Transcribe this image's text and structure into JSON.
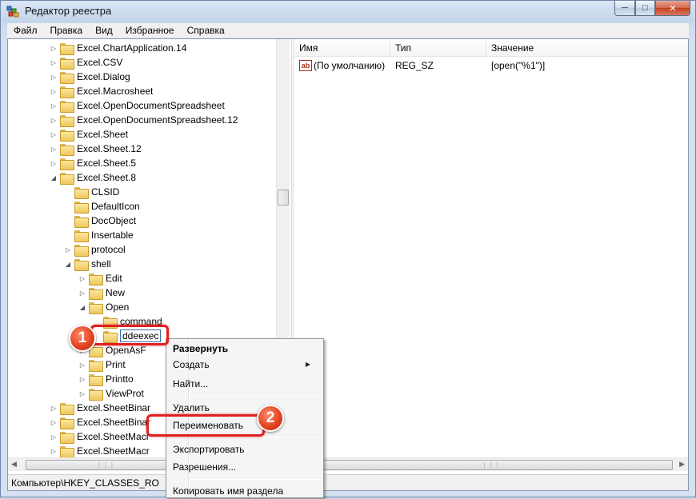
{
  "window": {
    "title": "Редактор реестра"
  },
  "menubar": {
    "items": [
      "Файл",
      "Правка",
      "Вид",
      "Избранное",
      "Справка"
    ]
  },
  "tree": {
    "rows": [
      {
        "label": "Excel.ChartApplication.14",
        "depth": 0,
        "expanded": false
      },
      {
        "label": "Excel.CSV",
        "depth": 0,
        "expanded": false
      },
      {
        "label": "Excel.Dialog",
        "depth": 0,
        "expanded": false
      },
      {
        "label": "Excel.Macrosheet",
        "depth": 0,
        "expanded": false
      },
      {
        "label": "Excel.OpenDocumentSpreadsheet",
        "depth": 0,
        "expanded": false
      },
      {
        "label": "Excel.OpenDocumentSpreadsheet.12",
        "depth": 0,
        "expanded": false
      },
      {
        "label": "Excel.Sheet",
        "depth": 0,
        "expanded": false
      },
      {
        "label": "Excel.Sheet.12",
        "depth": 0,
        "expanded": false
      },
      {
        "label": "Excel.Sheet.5",
        "depth": 0,
        "expanded": false
      },
      {
        "label": "Excel.Sheet.8",
        "depth": 0,
        "expanded": true
      },
      {
        "label": "CLSID",
        "depth": 1,
        "expanded": null
      },
      {
        "label": "DefaultIcon",
        "depth": 1,
        "expanded": null
      },
      {
        "label": "DocObject",
        "depth": 1,
        "expanded": null
      },
      {
        "label": "Insertable",
        "depth": 1,
        "expanded": null
      },
      {
        "label": "protocol",
        "depth": 1,
        "expanded": false
      },
      {
        "label": "shell",
        "depth": 1,
        "expanded": true
      },
      {
        "label": "Edit",
        "depth": 2,
        "expanded": false
      },
      {
        "label": "New",
        "depth": 2,
        "expanded": false
      },
      {
        "label": "Open",
        "depth": 2,
        "expanded": true
      },
      {
        "label": "command",
        "depth": 3,
        "expanded": null
      },
      {
        "label": "ddeexec",
        "depth": 3,
        "expanded": null
      },
      {
        "label": "OpenAsF",
        "depth": 2,
        "expanded": false
      },
      {
        "label": "Print",
        "depth": 2,
        "expanded": false
      },
      {
        "label": "Printto",
        "depth": 2,
        "expanded": false
      },
      {
        "label": "ViewProt",
        "depth": 2,
        "expanded": false
      },
      {
        "label": "Excel.SheetBinar",
        "depth": 0,
        "expanded": false
      },
      {
        "label": "Excel.SheetBinar",
        "depth": 0,
        "expanded": false
      },
      {
        "label": "Excel.SheetMacr",
        "depth": 0,
        "expanded": false
      },
      {
        "label": "Excel.SheetMacr",
        "depth": 0,
        "expanded": false
      }
    ]
  },
  "list": {
    "columns": [
      "Имя",
      "Тип",
      "Значение"
    ],
    "rows": [
      {
        "name": "(По умолчанию)",
        "type": "REG_SZ",
        "value": "[open(\"%1\")]",
        "icon": "ab"
      }
    ]
  },
  "statusbar": {
    "path": "Компьютер\\HKEY_CLASSES_RO"
  },
  "context_menu": {
    "items": [
      {
        "label": "Развернуть",
        "bold": true
      },
      {
        "label": "Создать",
        "submenu": true
      },
      {
        "label": "Найти..."
      },
      {
        "label": "Удалить"
      },
      {
        "label": "Переименовать"
      },
      {
        "label": "Экспортировать"
      },
      {
        "label": "Разрешения..."
      },
      {
        "label": "Копировать имя раздела"
      }
    ]
  },
  "annotations": {
    "badge1": "1",
    "badge2": "2",
    "color": "#e02020"
  }
}
